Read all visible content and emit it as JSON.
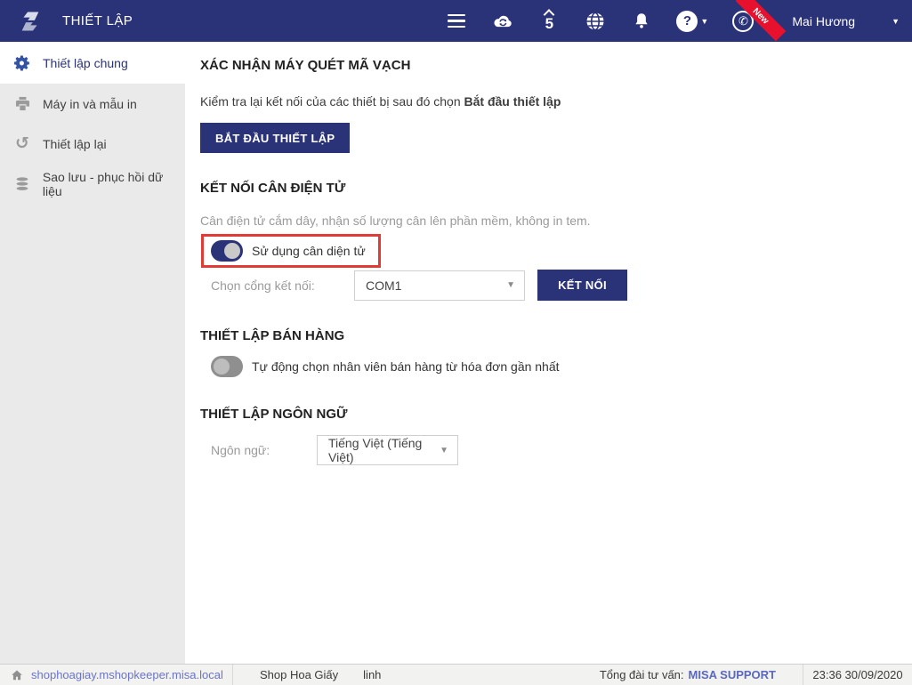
{
  "header": {
    "title": "THIẾT LẬP",
    "user": "Mai Hương",
    "new_badge": "New",
    "icons": {
      "menu": "hamburger",
      "cloud_sync": "cloud with sync arrows",
      "mshopkeeper": "5 logo",
      "globe": "globe",
      "bell": "notification bell",
      "help": "question mark",
      "phone": "support phone"
    }
  },
  "sidebar": {
    "items": [
      {
        "label": "Thiết lập chung",
        "active": true
      },
      {
        "label": "Máy in và mẫu in",
        "active": false
      },
      {
        "label": "Thiết lập lại",
        "active": false
      },
      {
        "label": "Sao lưu - phục hồi dữ liệu",
        "active": false
      }
    ]
  },
  "main": {
    "barcode_section": {
      "title": "XÁC NHẬN MÁY QUÉT MÃ VẠCH",
      "desc_prefix": "Kiểm tra lại kết nối của các thiết bị sau đó chọn ",
      "desc_bold": "Bắt đầu thiết lập",
      "start_button": "BẮT ĐẦU THIẾT LẬP"
    },
    "scale_section": {
      "title": "KẾT NỐI CÂN ĐIỆN TỬ",
      "desc": "Cân điện tử cắm dây, nhận số lượng cân lên phần mềm, không in tem.",
      "toggle_label": "Sử dụng cân diện tử",
      "toggle_state": "on",
      "port_label": "Chọn cổng kết nối:",
      "port_value": "COM1",
      "connect_button": "KẾT NỐI"
    },
    "sales_section": {
      "title": "THIẾT LẬP BÁN HÀNG",
      "toggle_label": "Tự động chọn nhân viên bán hàng từ hóa đơn gần nhất",
      "toggle_state": "off"
    },
    "language_section": {
      "title": "THIẾT LẬP NGÔN NGỮ",
      "label": "Ngôn ngữ:",
      "value": "Tiếng Việt (Tiếng Việt)"
    }
  },
  "footer": {
    "domain": "shophoagiay.mshopkeeper.misa.local",
    "shop_name": "Shop Hoa Giấy",
    "cashier": "linh",
    "support_label": "Tổng đài tư vấn:",
    "support_link": "MISA SUPPORT",
    "datetime": "23:36 30/09/2020"
  },
  "colors": {
    "header_bg": "#2b3378",
    "accent": "#2b3378",
    "highlight_red": "#e23b36",
    "ribbon_red": "#e8112d",
    "link_blue": "#5a68c0",
    "sidebar_bg": "#eaeaea"
  }
}
